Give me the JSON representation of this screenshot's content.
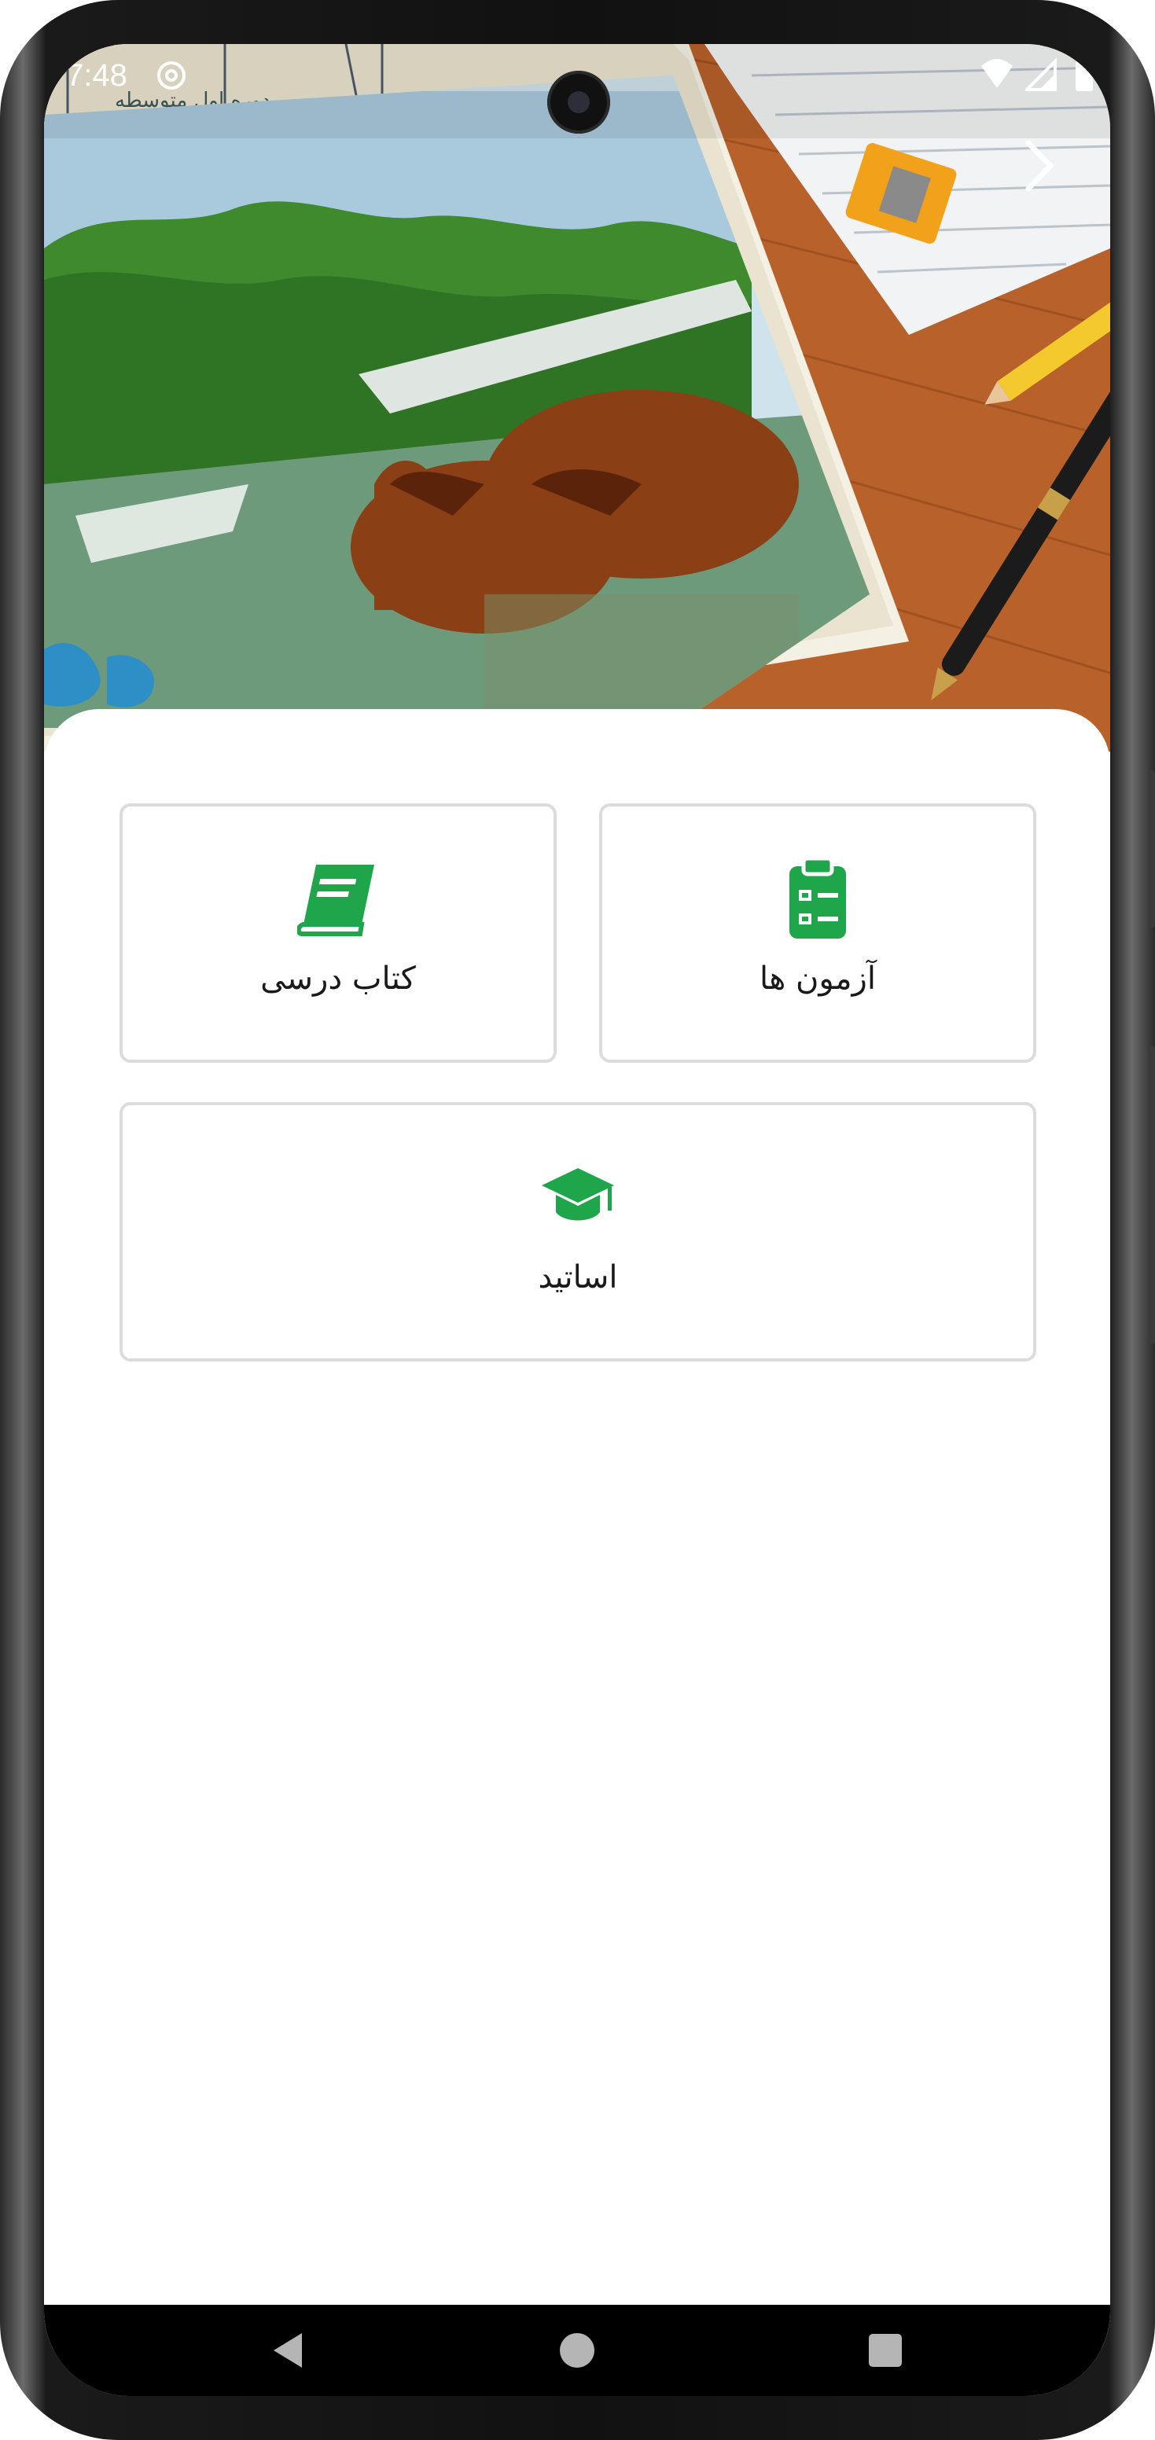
{
  "status_bar": {
    "time": "7:48",
    "icons": [
      "at-sign-icon",
      "wifi-icon",
      "signal-icon",
      "battery-icon"
    ]
  },
  "header": {
    "back_icon": "chevron-right-icon"
  },
  "cards": [
    {
      "id": "exams",
      "label": "آزمون ها",
      "icon": "clipboard-list-icon"
    },
    {
      "id": "textbook",
      "label": "کتاب درسی",
      "icon": "book-icon"
    },
    {
      "id": "teachers",
      "label": "اساتید",
      "icon": "graduation-cap-icon"
    }
  ],
  "colors": {
    "accent": "#1fa54a",
    "card_border": "#dcdcdc",
    "text": "#1a1a1a"
  },
  "navbar": {
    "buttons": [
      "back-triangle-icon",
      "home-circle-icon",
      "recents-square-icon"
    ]
  }
}
